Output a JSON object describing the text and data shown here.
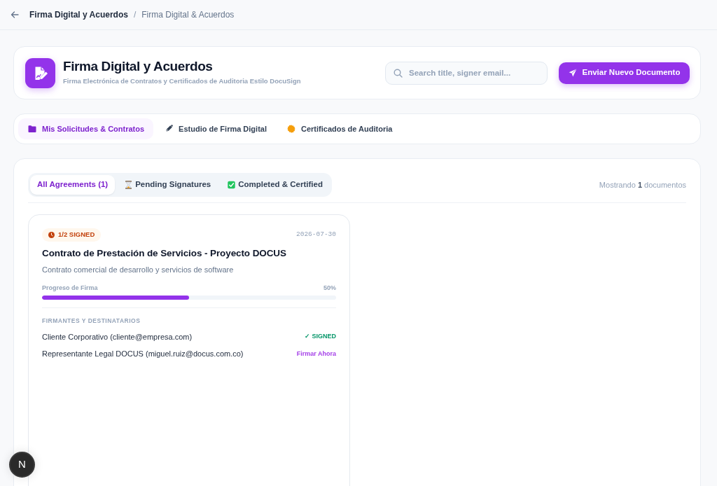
{
  "breadcrumb": {
    "items": [
      "Firma Digital y Acuerdos",
      "Firma Digital & Acuerdos"
    ],
    "separator": "/"
  },
  "header": {
    "title": "Firma Digital y Acuerdos",
    "subtitle": "Firma Electrónica de Contratos y Certificados de Auditoria Estilo DocuSign",
    "search": {
      "placeholder": "Search title, signer email..."
    },
    "primary_button": "Enviar Nuevo Documento"
  },
  "tabs": [
    {
      "label": "Mis Solicitudes & Contratos",
      "selected": true
    },
    {
      "label": "Estudio de Firma Digital",
      "selected": false
    },
    {
      "label": "Certificados de Auditoria",
      "selected": false
    }
  ],
  "filters": [
    {
      "label": "All Agreements (1)",
      "selected": true
    },
    {
      "label": "Pending Signatures",
      "selected": false
    },
    {
      "label": "Completed & Certified",
      "selected": false
    }
  ],
  "result_count": "Mostrando **1** documentos",
  "documents": [
    {
      "status": {
        "label": "1/2 SIGNED",
        "kind": "partial"
      },
      "date": "2026-07-30",
      "title": "Contrato de Prestación de Servicios - Proyecto DOCUS",
      "description": "Contrato comercial de desarrollo y servicios de software",
      "progress": {
        "label": "Progreso de Firma",
        "reading": "50%",
        "level": 0.5
      },
      "signers_heading": "FIRMANTES Y DESTINATARIOS",
      "signers": [
        {
          "name": "Cliente Corporativo (cliente@empresa.com)",
          "kind": "signed",
          "status": "✓ SIGNED"
        },
        {
          "name": "Representante Legal DOCUS (miguel.ruiz@docus.com.co)",
          "kind": "action",
          "status": "Firmar Ahora"
        }
      ]
    }
  ],
  "dev_badge": {
    "label": "N"
  }
}
